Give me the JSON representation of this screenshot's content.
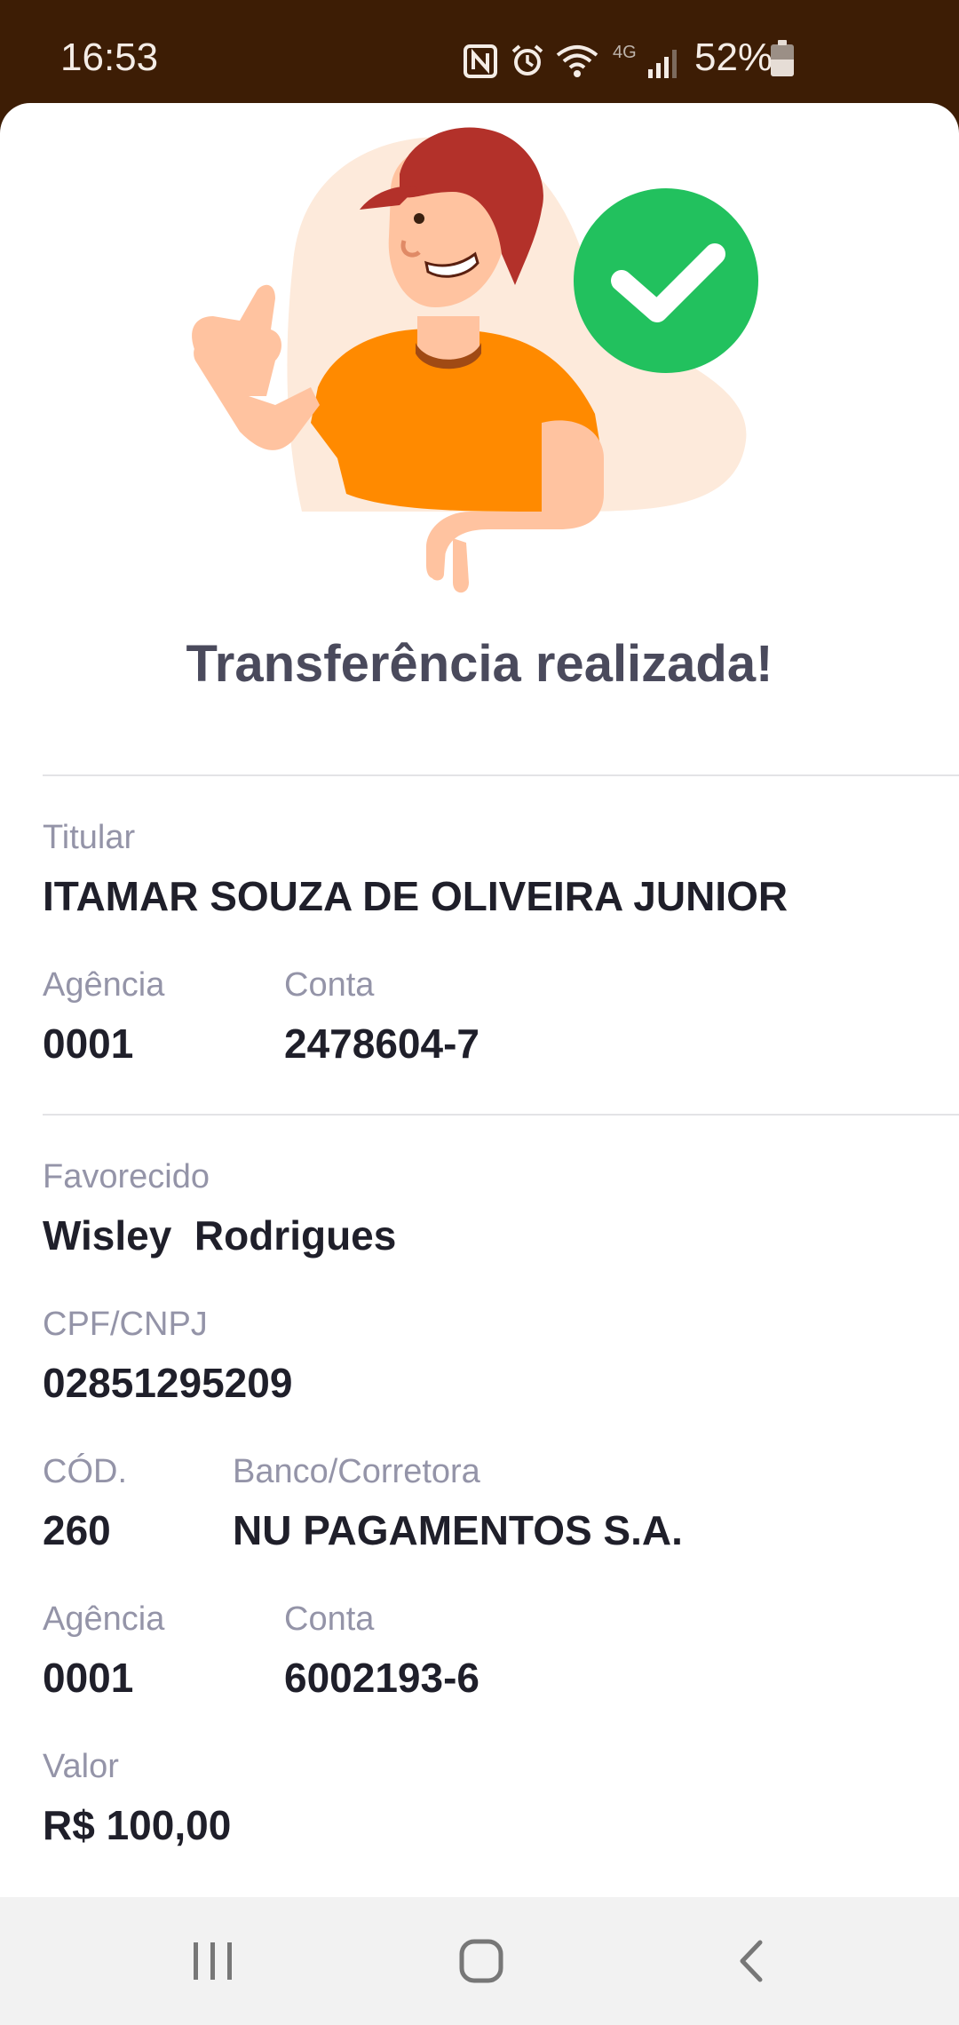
{
  "status_bar": {
    "time": "16:53",
    "network": "4G",
    "battery_percent": "52%",
    "battery_level": 0.52,
    "icons": [
      "nfc-icon",
      "alarm-icon",
      "wifi-icon",
      "signal-icon",
      "battery-icon"
    ]
  },
  "illustration": {
    "description_icon": "person-thumbs-up-illustration",
    "check_icon": "check-circle-icon",
    "check_color": "#22c15e"
  },
  "header": {
    "title": "Transferência realizada!"
  },
  "origin": {
    "holder_label": "Titular",
    "holder_value": "ITAMAR SOUZA DE OLIVEIRA JUNIOR",
    "agency_label": "Agência",
    "agency_value": "0001",
    "account_label": "Conta",
    "account_value": "2478604-7"
  },
  "recipient": {
    "name_label": "Favorecido",
    "name_value": "Wisley  Rodrigues",
    "doc_label": "CPF/CNPJ",
    "doc_value": "02851295209",
    "code_label": "CÓD.",
    "code_value": "260",
    "bank_label": "Banco/Corretora",
    "bank_value": "NU PAGAMENTOS S.A.",
    "agency_label": "Agência",
    "agency_value": "0001",
    "account_label": "Conta",
    "account_value": "6002193-6",
    "amount_label": "Valor",
    "amount_value": "R$ 100,00"
  },
  "nav": {
    "recents_icon": "recents-icon",
    "home_icon": "home-icon",
    "back_icon": "back-icon"
  },
  "colors": {
    "status_bar_bg": "#3d1d05",
    "title_text": "#4a4a5c",
    "label_text": "#9494a8",
    "value_text": "#1f1f2a",
    "shirt": "#ff8a00",
    "hair": "#b3312a",
    "skin": "#ffc3a0"
  }
}
